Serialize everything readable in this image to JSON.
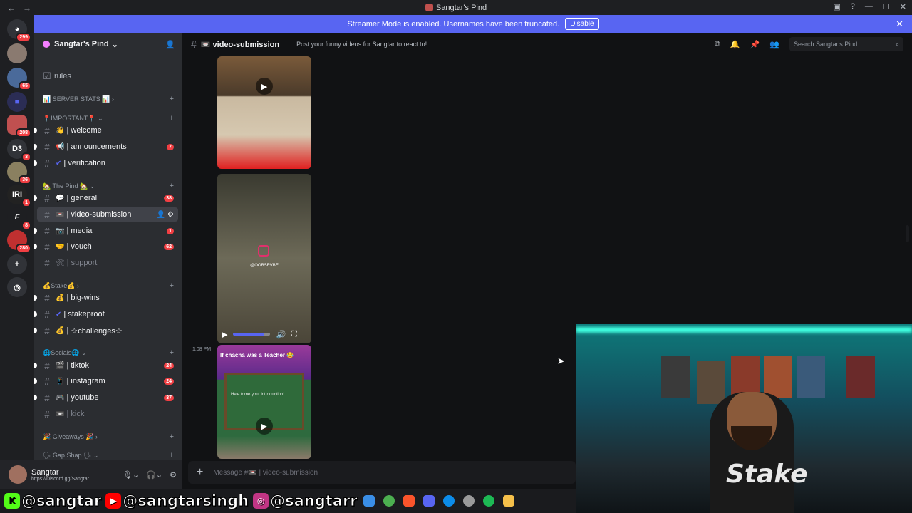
{
  "window": {
    "title": "Sangtar's Pind"
  },
  "banner": {
    "text": "Streamer Mode is enabled. Usernames have been truncated.",
    "disable": "Disable"
  },
  "guilds": [
    {
      "label": "",
      "badge": "299"
    },
    {
      "label": "",
      "badge": ""
    },
    {
      "label": "",
      "badge": "65"
    },
    {
      "label": "",
      "badge": ""
    },
    {
      "label": "",
      "badge": "208"
    },
    {
      "label": "D3",
      "badge": "3"
    },
    {
      "label": "",
      "badge": "36"
    },
    {
      "label": "IRI",
      "badge": "1"
    },
    {
      "label": "F",
      "badge": "8"
    },
    {
      "label": "",
      "badge": "280"
    }
  ],
  "server": {
    "name": "Sangtar's Pind"
  },
  "sidebar": {
    "rules": "rules",
    "categories": {
      "server_stats": "📊 SERVER STATS 📊",
      "important": "📍IMPORTANT📍",
      "the_pind": "🏡 The Pind 🏡",
      "stake": "💰Stake💰",
      "socials": "🌐Socials🌐",
      "giveaways": "🎉 Giveaways 🎉",
      "gap_shap": "🗣 Gap Shap 🗣"
    },
    "channels": [
      {
        "emoji": "👋",
        "name": "welcome",
        "count": ""
      },
      {
        "emoji": "📢",
        "name": "announcements",
        "count": "7"
      },
      {
        "emoji": "✔",
        "name": "verification",
        "count": ""
      },
      {
        "emoji": "💬",
        "name": "general",
        "count": "38"
      },
      {
        "emoji": "📼",
        "name": "video-submission",
        "count": ""
      },
      {
        "emoji": "📷",
        "name": "media",
        "count": "1"
      },
      {
        "emoji": "🤝",
        "name": "vouch",
        "count": "62"
      },
      {
        "emoji": "🛠",
        "name": "support",
        "count": ""
      },
      {
        "emoji": "💰",
        "name": "big-wins",
        "count": ""
      },
      {
        "emoji": "✔",
        "name": "stakeproof",
        "count": ""
      },
      {
        "emoji": "💰",
        "name": "☆challenges☆",
        "count": ""
      },
      {
        "emoji": "🎬",
        "name": "tiktok",
        "count": "24"
      },
      {
        "emoji": "📱",
        "name": "instagram",
        "count": "24"
      },
      {
        "emoji": "🎮",
        "name": "youtube",
        "count": "37"
      },
      {
        "emoji": "📼",
        "name": "kick",
        "count": ""
      }
    ]
  },
  "user": {
    "name": "Sangtar",
    "status": "https://Discord.gg/Sangtar"
  },
  "channel_header": {
    "name": "📼 video-submission",
    "topic": "Post your funny videos for Sangtar to react to!",
    "search_placeholder": "Search Sangtar's Pind"
  },
  "messages": {
    "timestamp": "1:08 PM",
    "video2_caption": "@OOBSRVBE",
    "video3_title": "If chacha was a Teacher 😂",
    "video3_board": "Hele tome your introduction!"
  },
  "composer": {
    "placeholder": "Message #📼 | video-submission"
  },
  "overlay": {
    "social_handles": [
      "@sangtar",
      "@sangtarsingh",
      "@sangtarr"
    ],
    "shirt_text": "Stake"
  }
}
